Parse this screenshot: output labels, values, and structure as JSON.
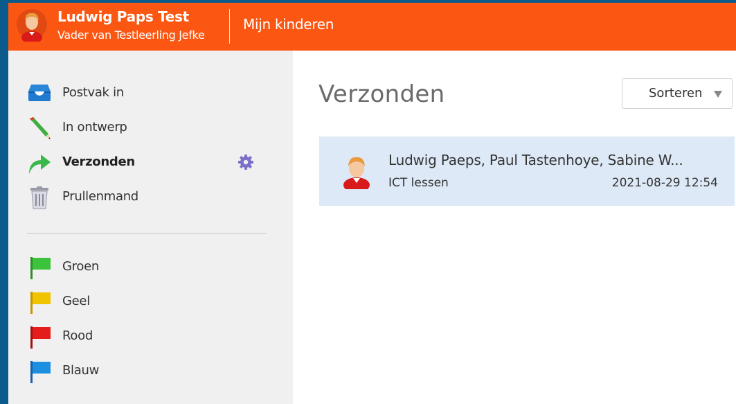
{
  "header": {
    "user_name": "Ludwig Paps Test",
    "user_role": "Vader van Testleerling Jefke",
    "nav_label": "Mijn kinderen",
    "brand_color": "#fb5612"
  },
  "sidebar": {
    "folders": [
      {
        "label": "Postvak in",
        "icon": "inbox-icon"
      },
      {
        "label": "In ontwerp",
        "icon": "pencil-icon"
      },
      {
        "label": "Verzonden",
        "icon": "sent-arrow-icon",
        "active": true
      },
      {
        "label": "Prullenmand",
        "icon": "trash-icon"
      }
    ],
    "flags": [
      {
        "label": "Groen",
        "color": "#3cc23c"
      },
      {
        "label": "Geel",
        "color": "#f2c300"
      },
      {
        "label": "Rood",
        "color": "#e51c1c"
      },
      {
        "label": "Blauw",
        "color": "#1e8fe0"
      }
    ]
  },
  "main": {
    "title": "Verzonden",
    "sort_label": "Sorteren",
    "messages": [
      {
        "recipients": "Ludwig Paeps, Paul Tastenhoye, Sabine W...",
        "subject": "ICT lessen",
        "date": "2021-08-29 12:54"
      }
    ]
  }
}
